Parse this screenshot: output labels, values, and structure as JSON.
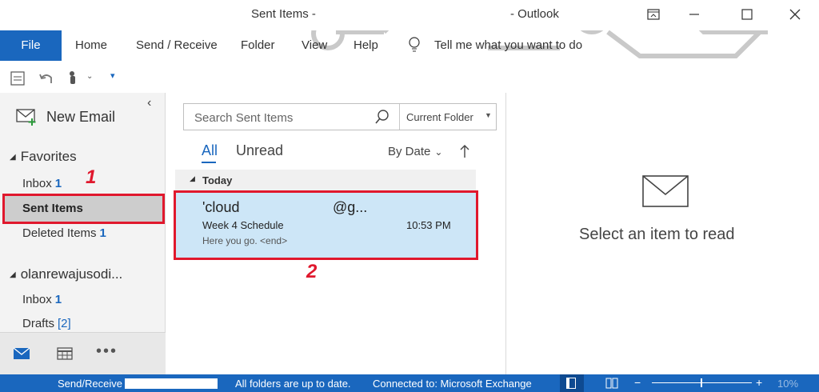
{
  "window": {
    "title_left": "Sent Items -",
    "title_right": "- Outlook"
  },
  "ribbon": {
    "file": "File",
    "tabs": [
      "Home",
      "Send / Receive",
      "Folder",
      "View",
      "Help"
    ],
    "tell_me": "Tell me what you want to do"
  },
  "nav": {
    "new_email": "New Email",
    "favorites": "Favorites",
    "inbox": "Inbox",
    "inbox_count": "1",
    "sent_items": "Sent Items",
    "deleted_items": "Deleted Items",
    "deleted_count": "1",
    "account": "olanrewajusodi...",
    "account_inbox": "Inbox",
    "account_inbox_count": "1",
    "drafts": "Drafts",
    "drafts_count": "[2]"
  },
  "list": {
    "search_placeholder": "Search Sent Items",
    "scope": "Current Folder",
    "filter_all": "All",
    "filter_unread": "Unread",
    "sort": "By Date",
    "group_today": "Today",
    "message": {
      "to": "'cloud",
      "to_domain": "@g...",
      "subject": "Week 4 Schedule",
      "time": "10:53 PM",
      "preview": "Here you go. <end>"
    }
  },
  "reading": {
    "empty_text": "Select an item to read"
  },
  "status": {
    "send_receive": "Send/Receive",
    "folders": "All folders are up to date.",
    "connection": "Connected to: Microsoft Exchange",
    "zoom": "10%"
  },
  "annotations": {
    "step1": "1",
    "step2": "2",
    "color": "#e0182d"
  },
  "colors": {
    "accent": "#1a67be",
    "selected": "#cde6f7"
  }
}
